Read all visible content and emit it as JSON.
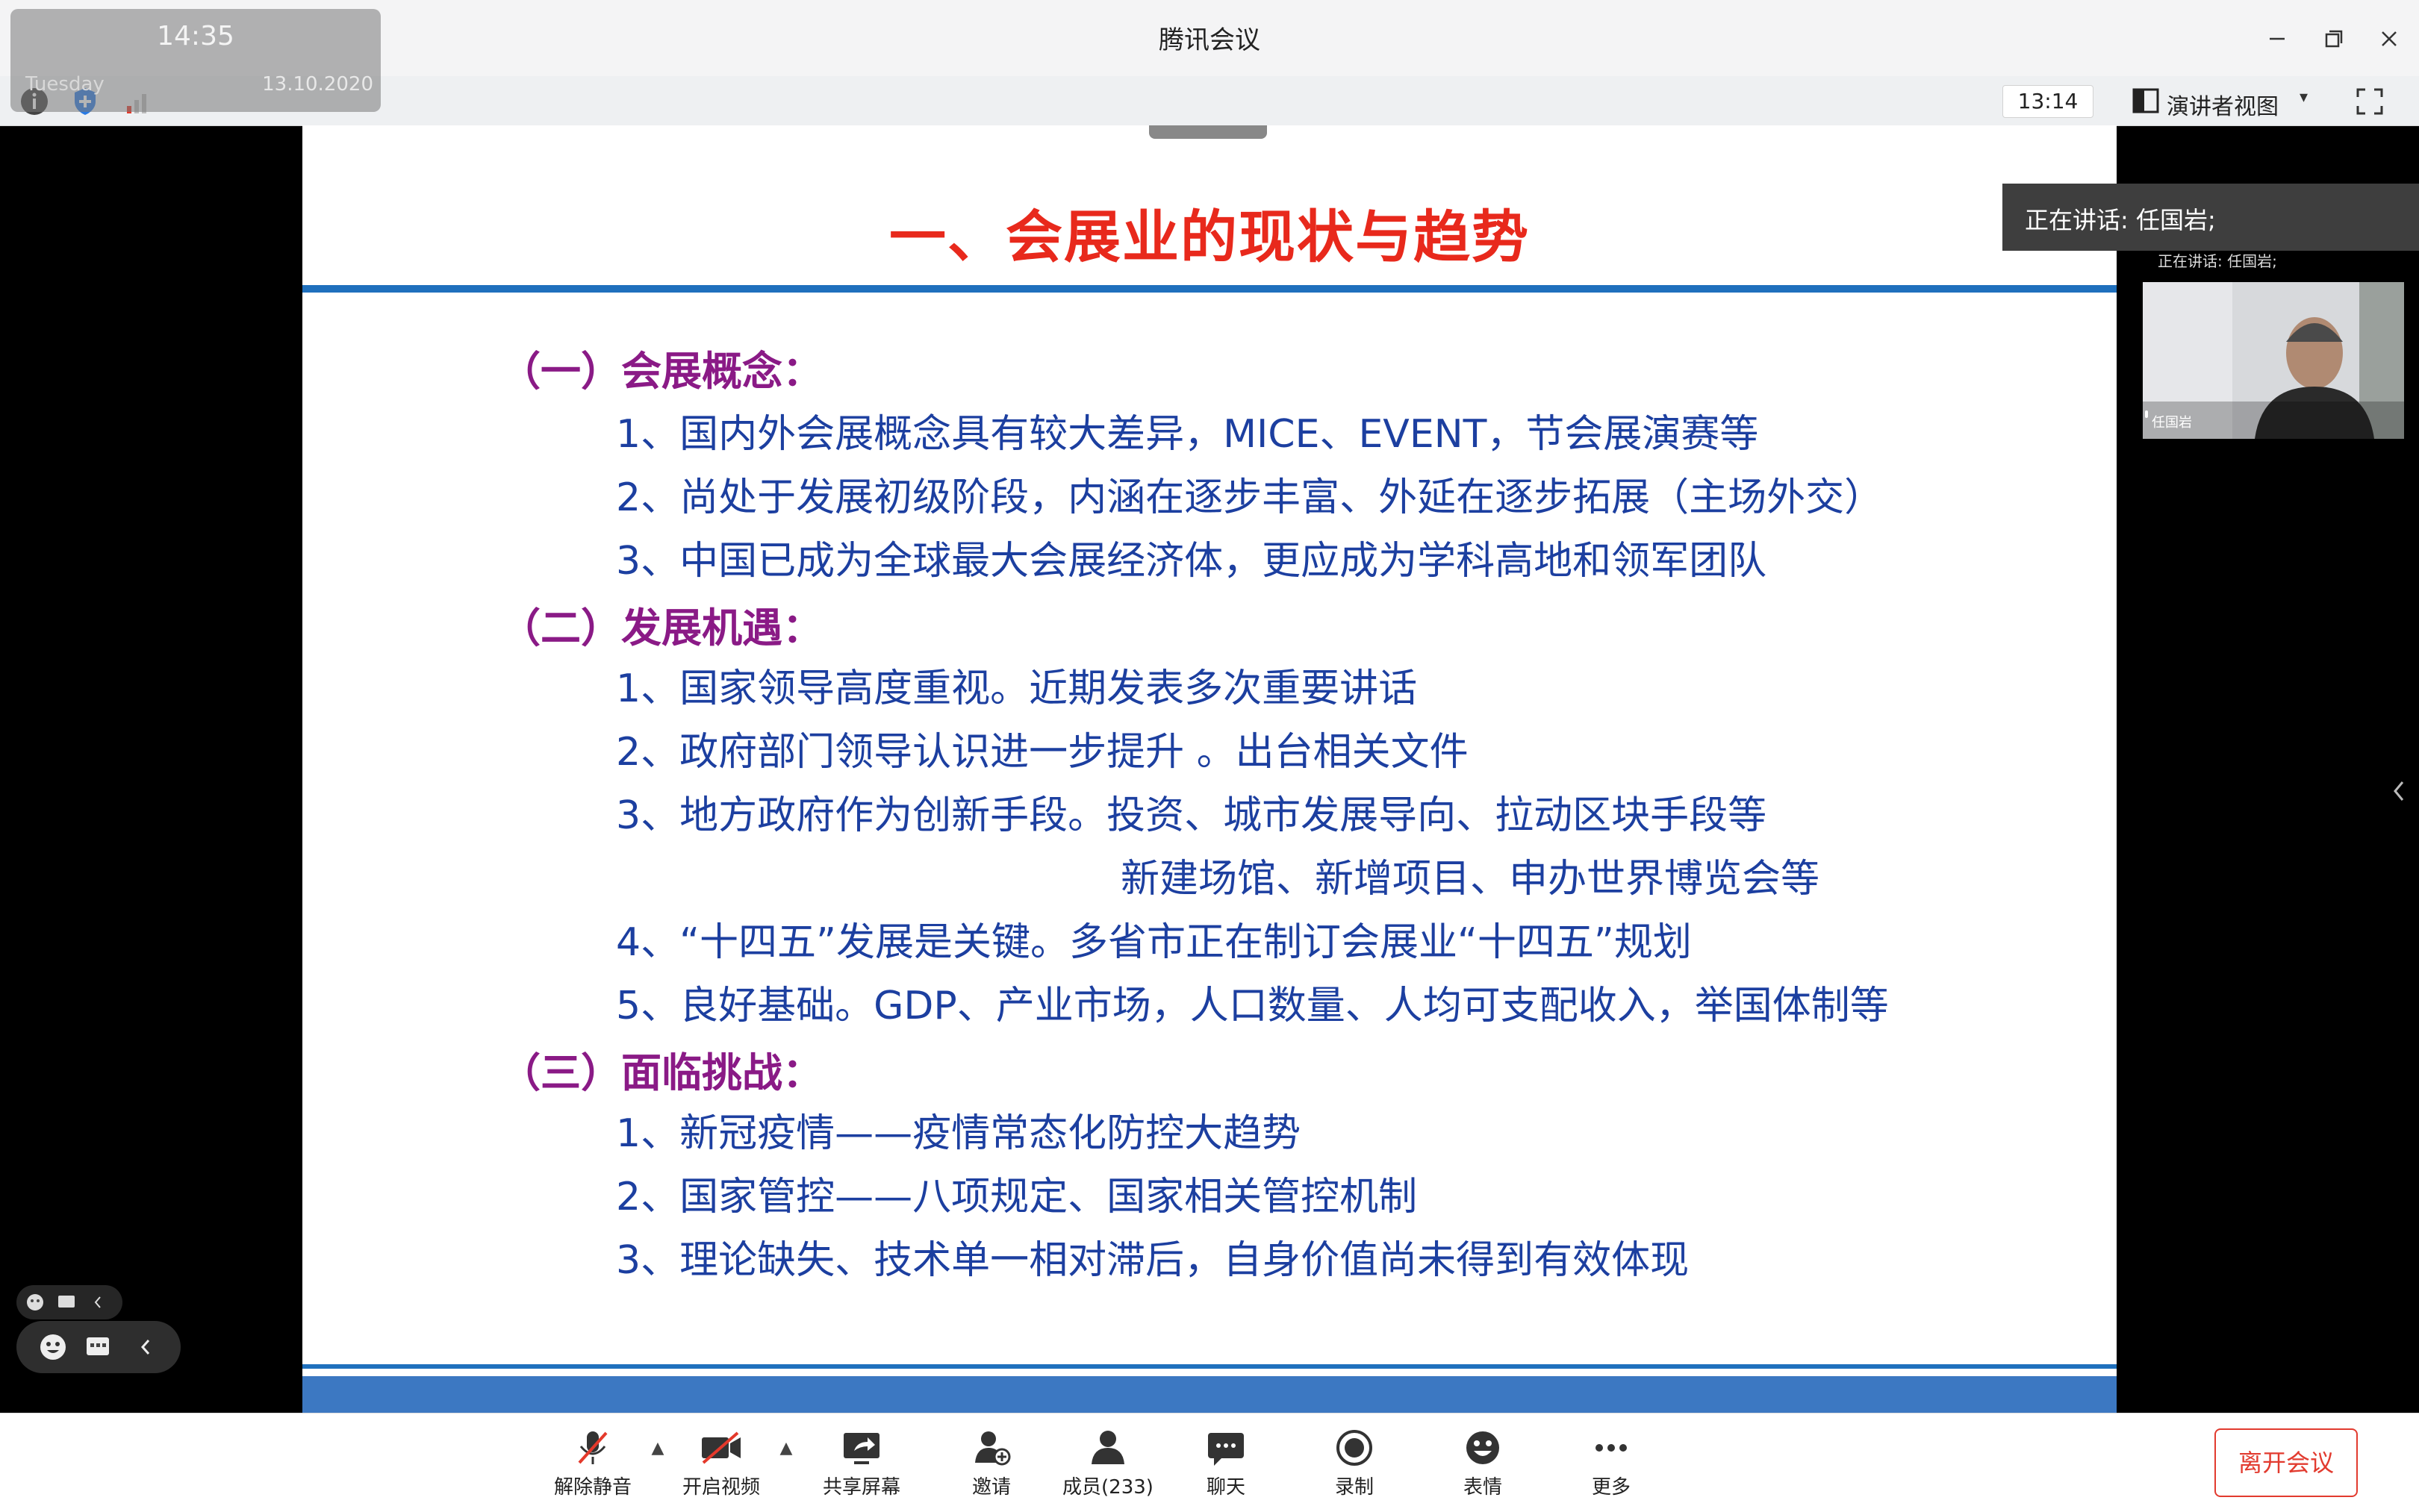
{
  "window": {
    "title": "腾讯会议"
  },
  "clock": {
    "time": "14:35",
    "date": "13.10.2020",
    "day": "Tuesday"
  },
  "toolbar": {
    "timer": "13:14",
    "view_mode_label": "演讲者视图",
    "icons": [
      "info-icon",
      "shield-icon",
      "signal-icon",
      "layout-icon",
      "fullscreen-icon"
    ]
  },
  "slide": {
    "title": "一、会展业的现状与趋势",
    "sections": [
      {
        "heading": "（一）会展概念：",
        "items": [
          "1、国内外会展概念具有较大差异，MICE、EVENT，节会展演赛等",
          "2、尚处于发展初级阶段，内涵在逐步丰富、外延在逐步拓展（主场外交）",
          "3、中国已成为全球最大会展经济体，更应成为学科高地和领军团队"
        ]
      },
      {
        "heading": "（二）发展机遇：",
        "items": [
          "1、国家领导高度重视。近期发表多次重要讲话",
          "2、政府部门领导认识进一步提升 。出台相关文件",
          "3、地方政府作为创新手段。投资、城市发展导向、拉动区块手段等",
          "新建场馆、新增项目、申办世界博览会等",
          "4、“十四五”发展是关键。多省市正在制订会展业“十四五”规划",
          "5、良好基础。GDP、产业市场，人口数量、人均可支配收入，举国体制等"
        ]
      },
      {
        "heading": "（三）面临挑战：",
        "items": [
          "1、新冠疫情——疫情常态化防控大趋势",
          "2、国家管控——八项规定、国家相关管控机制",
          "3、理论缺失、技术单一相对滞后，自身价值尚未得到有效体现"
        ]
      }
    ]
  },
  "speaker": {
    "banner": "正在讲话: 任国岩;",
    "mini": "正在讲话: 任国岩;",
    "tile_name": "任国岩"
  },
  "bottombar": {
    "buttons": [
      {
        "label": "解除静音",
        "icon": "mic-muted-icon"
      },
      {
        "label": "开启视频",
        "icon": "camera-off-icon"
      },
      {
        "label": "共享屏幕",
        "icon": "share-screen-icon"
      },
      {
        "label": "邀请",
        "icon": "invite-icon"
      },
      {
        "label": "成员(233)",
        "icon": "members-icon"
      },
      {
        "label": "聊天",
        "icon": "chat-icon"
      },
      {
        "label": "录制",
        "icon": "record-icon"
      },
      {
        "label": "表情",
        "icon": "emoji-icon"
      },
      {
        "label": "更多",
        "icon": "more-icon"
      }
    ],
    "leave_label": "离开会议"
  },
  "colors": {
    "title_red": "#e8291c",
    "rule_blue": "#1f70bd",
    "heading_purple": "#8a1a86",
    "item_blue": "#1c3fa0",
    "leave_red": "#e23b2f"
  }
}
